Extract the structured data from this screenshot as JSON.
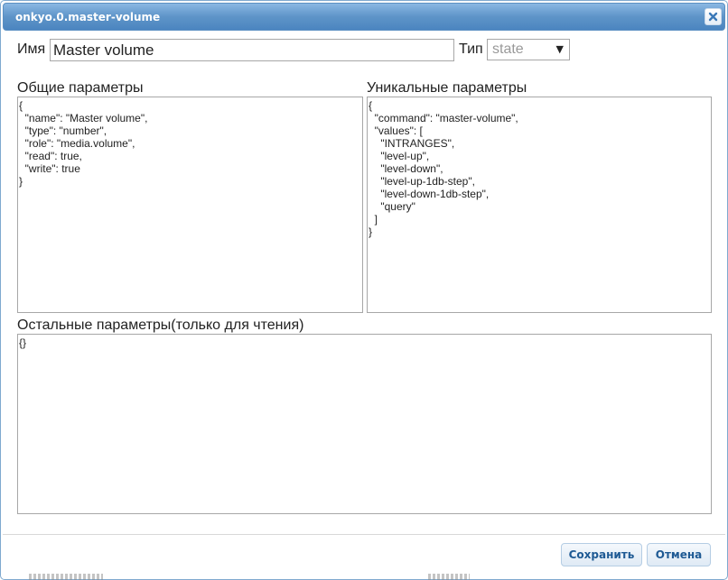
{
  "dialog": {
    "title": "onkyo.0.master-volume"
  },
  "fields": {
    "name_label": "Имя",
    "name_value": "Master volume",
    "type_label": "Тип",
    "type_value": "state"
  },
  "sections": {
    "common_label": "Общие параметры",
    "common_json": "{\n  \"name\": \"Master volume\",\n  \"type\": \"number\",\n  \"role\": \"media.volume\",\n  \"read\": true,\n  \"write\": true\n}",
    "unique_label": "Уникальные параметры",
    "unique_json": "{\n  \"command\": \"master-volume\",\n  \"values\": [\n    \"INTRANGES\",\n    \"level-up\",\n    \"level-down\",\n    \"level-up-1db-step\",\n    \"level-down-1db-step\",\n    \"query\"\n  ]\n}",
    "other_label": "Остальные параметры(только для чтения)",
    "other_json": "{}"
  },
  "buttons": {
    "save": "Сохранить",
    "cancel": "Отмена"
  }
}
